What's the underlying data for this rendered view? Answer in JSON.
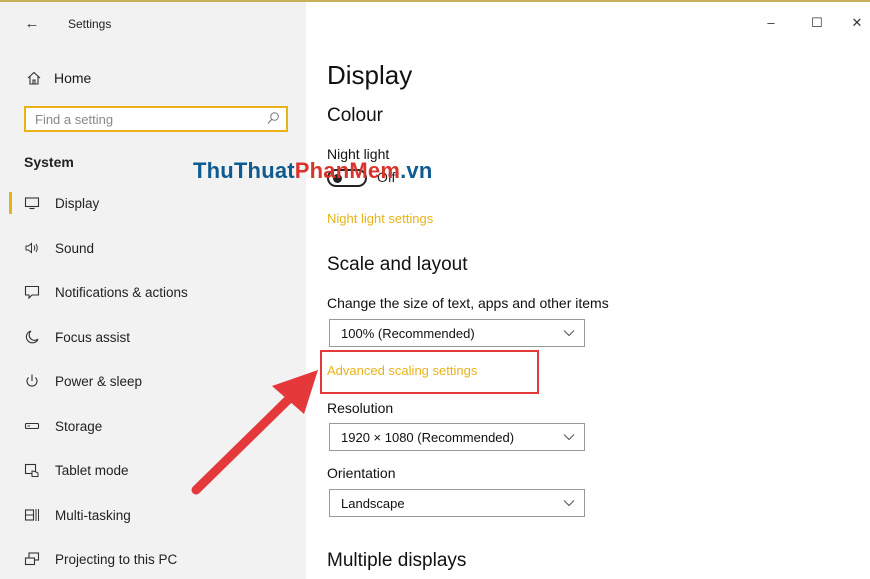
{
  "app": {
    "title": "Settings",
    "back_icon": "back-arrow-icon"
  },
  "window_controls": {
    "minimize": "–",
    "maximize": "☐",
    "close": "✕"
  },
  "sidebar": {
    "home_label": "Home",
    "search_placeholder": "Find a setting",
    "section_title": "System",
    "items": [
      {
        "label": "Display",
        "icon": "monitor-icon",
        "active": true
      },
      {
        "label": "Sound",
        "icon": "speaker-icon"
      },
      {
        "label": "Notifications & actions",
        "icon": "notification-icon"
      },
      {
        "label": "Focus assist",
        "icon": "moon-icon"
      },
      {
        "label": "Power & sleep",
        "icon": "power-icon"
      },
      {
        "label": "Storage",
        "icon": "storage-icon"
      },
      {
        "label": "Tablet mode",
        "icon": "tablet-icon"
      },
      {
        "label": "Multi-tasking",
        "icon": "multitask-icon"
      },
      {
        "label": "Projecting to this PC",
        "icon": "project-icon"
      }
    ]
  },
  "main": {
    "title": "Display",
    "colour_heading": "Colour",
    "night_light_label": "Night light",
    "night_light_state": "Off",
    "night_light_settings_link": "Night light settings",
    "scale_heading": "Scale and layout",
    "scale_label": "Change the size of text, apps and other items",
    "scale_value": "100% (Recommended)",
    "advanced_scaling_link": "Advanced scaling settings",
    "resolution_label": "Resolution",
    "resolution_value": "1920 × 1080 (Recommended)",
    "orientation_label": "Orientation",
    "orientation_value": "Landscape",
    "multiple_displays_heading": "Multiple displays"
  },
  "watermark": {
    "part1": "ThuThuat",
    "part2": "PhanMem",
    "part3": ".vn"
  },
  "colors": {
    "accent": "#e8b318",
    "annotation_red": "#e4383b",
    "sidebar_bg": "#f2f2f2"
  }
}
